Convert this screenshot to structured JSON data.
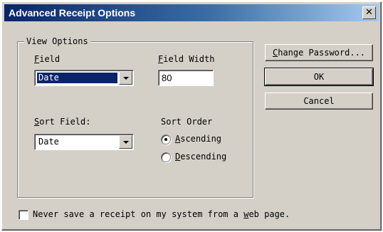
{
  "window": {
    "title": "Advanced Receipt Options",
    "close_glyph": "✕"
  },
  "view_options": {
    "group_label": "View Options",
    "field": {
      "label_prefix": "",
      "label_access": "F",
      "label_rest": "ield",
      "value": "Date"
    },
    "field_width": {
      "label_access": "F",
      "label_rest": "ield Width",
      "value": "80"
    },
    "sort_field": {
      "label_access": "S",
      "label_rest": "ort Field:",
      "value": "Date"
    },
    "sort_order": {
      "label": "Sort Order",
      "options": [
        {
          "access": "A",
          "rest": "scending",
          "checked": true
        },
        {
          "access": "D",
          "rest": "escending",
          "checked": false
        }
      ]
    }
  },
  "buttons": {
    "change_password": {
      "access": "C",
      "rest": "hange Password..."
    },
    "ok": "OK",
    "cancel": "Cancel"
  },
  "never_save": {
    "pre": "Never save a receipt on my system from a ",
    "access": "w",
    "post": "eb page.",
    "checked": false
  },
  "colors": {
    "title_start": "#0a246a",
    "title_end": "#a6caf0",
    "face": "#d4d0c8"
  },
  "icons": [
    "close-icon",
    "dropdown-arrow-icon"
  ]
}
